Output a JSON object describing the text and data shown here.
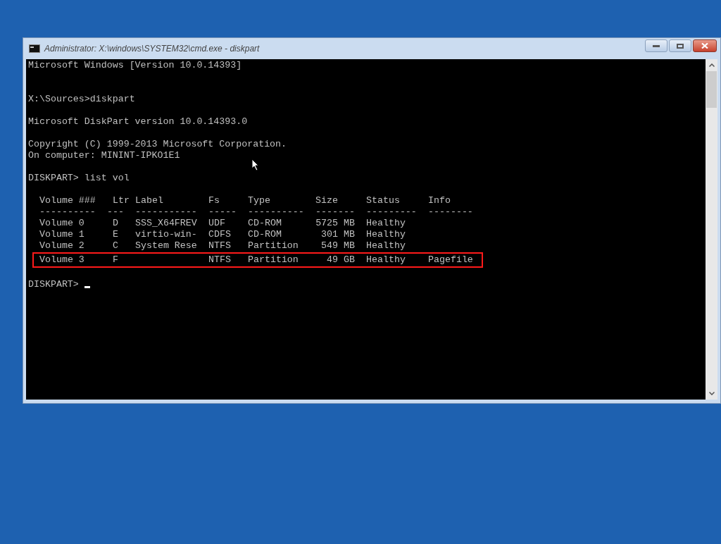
{
  "window": {
    "title": "Administrator: X:\\windows\\SYSTEM32\\cmd.exe - diskpart"
  },
  "console": {
    "lines": [
      {
        "kind": "text",
        "text": "Microsoft Windows [Version 10.0.14393]"
      },
      {
        "kind": "blank"
      },
      {
        "kind": "blank"
      },
      {
        "kind": "text",
        "text": "X:\\Sources>diskpart"
      },
      {
        "kind": "blank"
      },
      {
        "kind": "text",
        "text": "Microsoft DiskPart version 10.0.14393.0"
      },
      {
        "kind": "blank"
      },
      {
        "kind": "text",
        "text": "Copyright (C) 1999-2013 Microsoft Corporation."
      },
      {
        "kind": "text",
        "text": "On computer: MININT-IPKO1E1"
      },
      {
        "kind": "blank"
      },
      {
        "kind": "text",
        "text": "DISKPART> list vol"
      },
      {
        "kind": "blank"
      }
    ],
    "table": {
      "columns": [
        "Volume ###",
        "Ltr",
        "Label",
        "Fs",
        "Type",
        "Size",
        "Status",
        "Info"
      ],
      "dashes": [
        "----------",
        "---",
        "-----------",
        "-----",
        "----------",
        "-------",
        "---------",
        "--------"
      ],
      "rows": [
        {
          "volume": "Volume 0",
          "ltr": "D",
          "label": "SSS_X64FREV",
          "fs": "UDF",
          "type": "CD-ROM",
          "size": "5725 MB",
          "status": "Healthy",
          "highlighted": false
        },
        {
          "volume": "Volume 1",
          "ltr": "E",
          "label": "virtio-win-",
          "fs": "CDFS",
          "type": "CD-ROM",
          "size": "301 MB",
          "status": "Healthy",
          "highlighted": false
        },
        {
          "volume": "Volume 2",
          "ltr": "C",
          "label": "System Rese",
          "fs": "NTFS",
          "type": "Partition",
          "size": "549 MB",
          "status": "Healthy",
          "highlighted": false
        },
        {
          "volume": "Volume 3",
          "ltr": "F",
          "fs": "NTFS",
          "type": "Partition",
          "size": "49 GB",
          "status": "Healthy",
          "info": "Pagefile",
          "highlighted": true
        }
      ]
    },
    "prompt": "DISKPART>"
  }
}
